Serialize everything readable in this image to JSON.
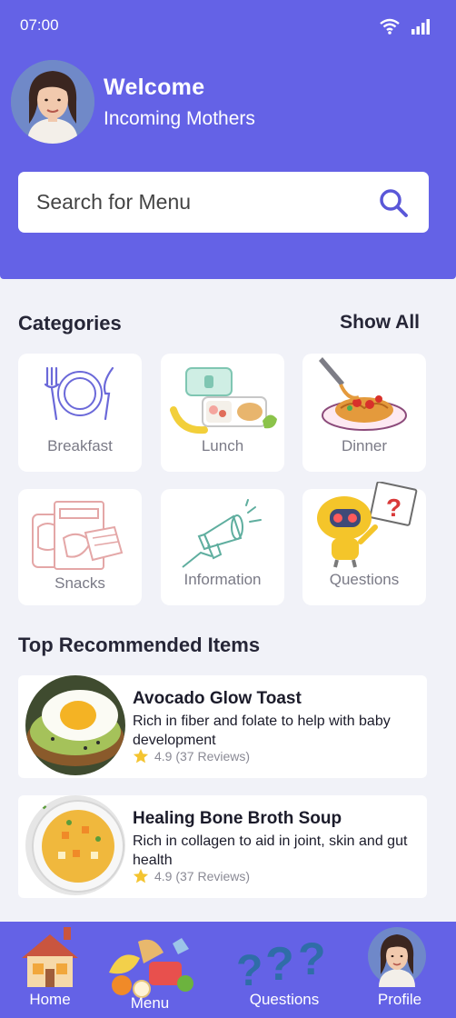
{
  "status_bar": {
    "time": "07:00",
    "icons": [
      "wifi-icon",
      "signal-icon"
    ]
  },
  "header": {
    "welcome": "Welcome",
    "subtitle": "Incoming Mothers"
  },
  "search": {
    "placeholder": "Search for Menu",
    "value": ""
  },
  "categories": {
    "title": "Categories",
    "show_all": "Show All",
    "items": [
      {
        "label": "Breakfast",
        "icon": "plate-cutlery-icon"
      },
      {
        "label": "Lunch",
        "icon": "lunchbox-icon"
      },
      {
        "label": "Dinner",
        "icon": "spaghetti-icon"
      },
      {
        "label": "Snacks",
        "icon": "snacks-icon"
      },
      {
        "label": "Information",
        "icon": "megaphone-icon"
      },
      {
        "label": "Questions",
        "icon": "robot-question-icon"
      }
    ]
  },
  "recommended": {
    "title": "Top Recommended Items",
    "items": [
      {
        "name": "Avocado Glow Toast",
        "description": "Rich in fiber and folate to help with baby development",
        "rating": "4.9 (37 Reviews)"
      },
      {
        "name": "Healing Bone Broth Soup",
        "description": "Rich in collagen to aid in joint, skin and gut health",
        "rating": "4.9 (37 Reviews)"
      }
    ]
  },
  "nav": [
    {
      "label": "Home",
      "icon": "house-icon"
    },
    {
      "label": "Menu",
      "icon": "food-icon"
    },
    {
      "label": "Questions",
      "icon": "question-marks-icon"
    },
    {
      "label": "Profile",
      "icon": "avatar-icon"
    }
  ],
  "colors": {
    "primary": "#6462e6",
    "background": "#f1f2f8",
    "card": "#ffffff",
    "star": "#f4c430"
  }
}
